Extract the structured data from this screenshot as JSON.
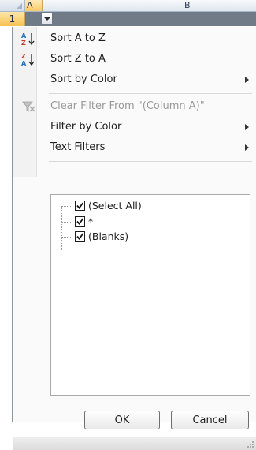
{
  "sheet": {
    "columns": [
      "A",
      "B"
    ],
    "row_number": "1"
  },
  "filter_menu": {
    "items": [
      {
        "id": "sort-a-z",
        "label": "Sort A to Z",
        "icon": "sort-ascending-icon",
        "enabled": true,
        "submenu": false
      },
      {
        "id": "sort-z-a",
        "label": "Sort Z to A",
        "icon": "sort-descending-icon",
        "enabled": true,
        "submenu": false
      },
      {
        "id": "sort-by-color",
        "label": "Sort by Color",
        "icon": "",
        "enabled": true,
        "submenu": true
      },
      {
        "id": "clear-filter",
        "label": "Clear Filter From \"(Column A)\"",
        "icon": "clear-filter-icon",
        "enabled": false,
        "submenu": false
      },
      {
        "id": "filter-by-color",
        "label": "Filter by Color",
        "icon": "",
        "enabled": true,
        "submenu": true
      },
      {
        "id": "text-filters",
        "label": "Text Filters",
        "icon": "",
        "enabled": true,
        "submenu": true
      }
    ],
    "checklist": [
      {
        "label": "(Select All)",
        "checked": true
      },
      {
        "label": "*",
        "checked": true
      },
      {
        "label": "(Blanks)",
        "checked": true
      }
    ],
    "ok_label": "OK",
    "cancel_label": "Cancel"
  }
}
